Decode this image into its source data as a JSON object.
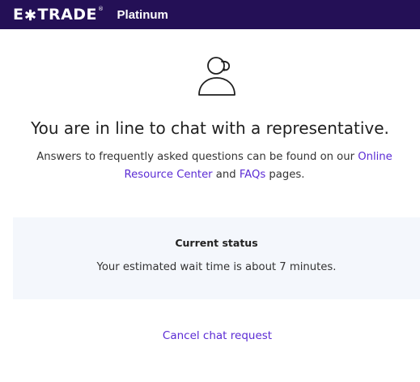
{
  "header": {
    "logo_text_left": "E",
    "logo_text_right": "TRADE",
    "logo_reg_mark": "®",
    "tier_label": "Platinum",
    "background_color": "#241056"
  },
  "main": {
    "icon": "chat-representative-icon",
    "headline": "You are in line to chat with a representative.",
    "help_text_prefix": "Answers to frequently asked questions can be found on our ",
    "help_link_resource_center": "Online Resource Center",
    "help_text_middle": " and ",
    "help_link_faqs": "FAQs",
    "help_text_suffix": " pages."
  },
  "status": {
    "title": "Current status",
    "message": "Your estimated wait time is about 7 minutes."
  },
  "actions": {
    "cancel_label": "Cancel chat request"
  },
  "colors": {
    "link": "#5b2bd4",
    "panel_background": "#f4f7fc"
  }
}
